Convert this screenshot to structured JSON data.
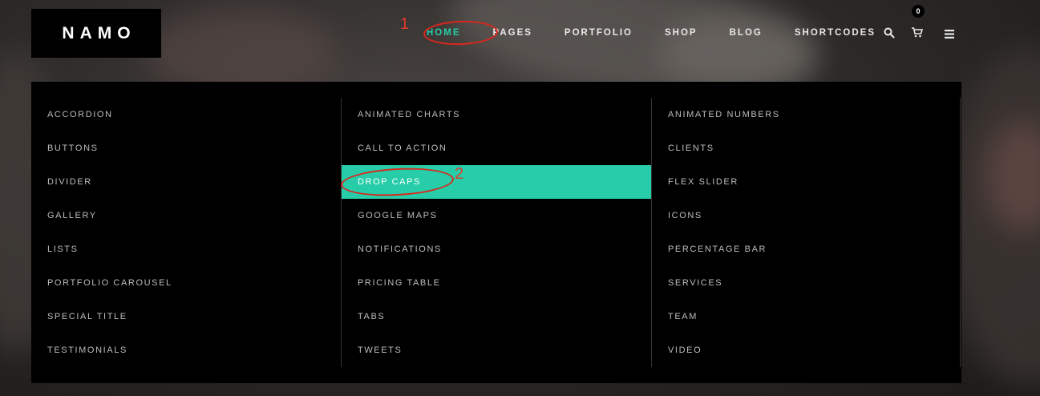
{
  "header": {
    "logo": "NAMO",
    "nav": [
      {
        "label": "HOME",
        "active": true
      },
      {
        "label": "PAGES",
        "active": false
      },
      {
        "label": "PORTFOLIO",
        "active": false
      },
      {
        "label": "SHOP",
        "active": false
      },
      {
        "label": "BLOG",
        "active": false
      },
      {
        "label": "SHORTCODES",
        "active": false
      }
    ],
    "cart_count": "0",
    "icons": [
      "search-icon",
      "cart-icon",
      "menu-icon"
    ]
  },
  "mega_menu": {
    "columns": [
      [
        "ACCORDION",
        "BUTTONS",
        "DIVIDER",
        "GALLERY",
        "LISTS",
        "PORTFOLIO CAROUSEL",
        "SPECIAL TITLE",
        "TESTIMONIALS"
      ],
      [
        "ANIMATED CHARTS",
        "CALL TO ACTION",
        "DROP CAPS",
        "GOOGLE MAPS",
        "NOTIFICATIONS",
        "PRICING TABLE",
        "TABS",
        "TWEETS"
      ],
      [
        "ANIMATED NUMBERS",
        "CLIENTS",
        "FLEX SLIDER",
        "ICONS",
        "PERCENTAGE BAR",
        "SERVICES",
        "TEAM",
        "VIDEO"
      ]
    ],
    "highlighted": "DROP CAPS"
  },
  "annotations": [
    "1",
    "2"
  ],
  "colors": {
    "accent": "#26cda8",
    "annotation": "#d9271d",
    "panel": "#000000"
  }
}
